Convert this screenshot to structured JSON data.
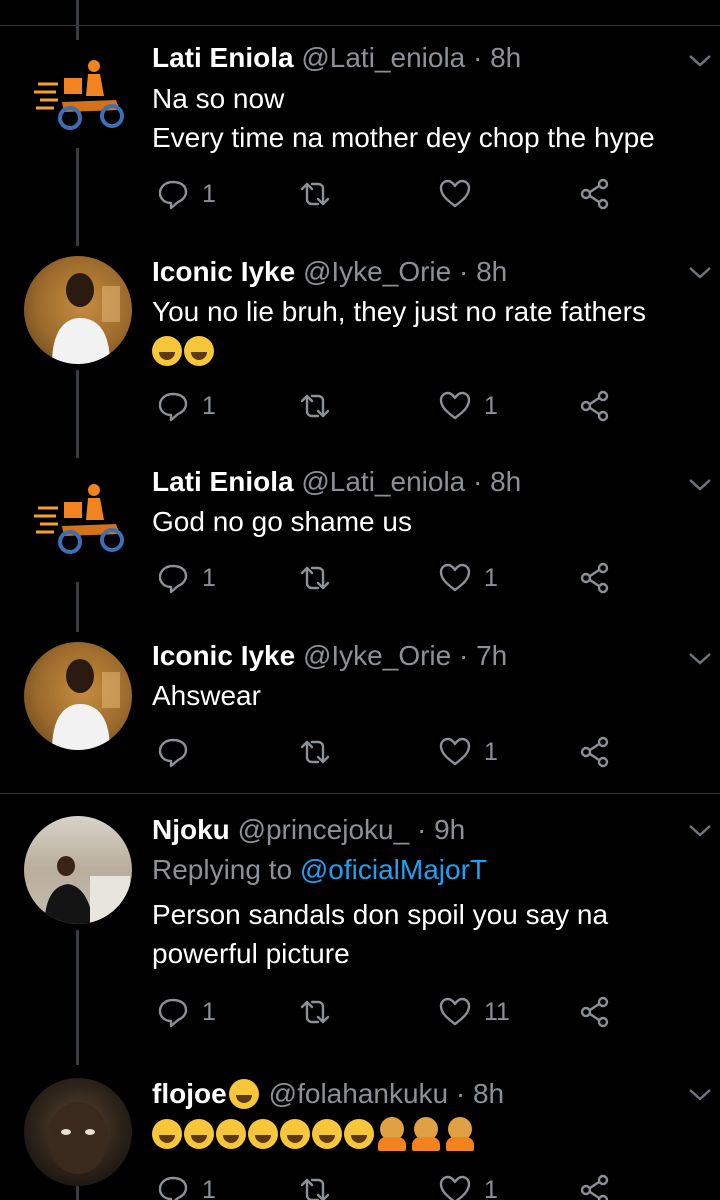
{
  "tweets": [
    {
      "name": "Lati Eniola",
      "meta": "@Lati_eniola · 8h",
      "lines": [
        "Na so now",
        "Every time na mother dey chop the hype"
      ],
      "replies": "1",
      "retweets": "",
      "likes": "",
      "avatar": "rider-logo"
    },
    {
      "name": "Iconic Iyke",
      "meta": "@Iyke_Orie · 8h",
      "lines": [
        "You no lie bruh, they just no rate fathers"
      ],
      "emojis": [
        "face-with-tears-of-joy",
        "grinning-squinting-face"
      ],
      "replies": "1",
      "retweets": "",
      "likes": "1",
      "avatar": "profile-photo"
    },
    {
      "name": "Lati Eniola",
      "meta": "@Lati_eniola · 8h",
      "lines": [
        "God no go shame us"
      ],
      "replies": "1",
      "retweets": "",
      "likes": "1",
      "avatar": "rider-logo"
    },
    {
      "name": "Iconic Iyke",
      "meta": "@Iyke_Orie · 7h",
      "lines": [
        "Ahswear"
      ],
      "replies": "",
      "retweets": "",
      "likes": "1",
      "avatar": "profile-photo"
    },
    {
      "name": "Njoku",
      "meta": "@princejoku_ · 9h",
      "replying_prefix": "Replying to",
      "replying_handle": "@oficialMajorT",
      "lines": [
        "Person sandals don spoil you say na",
        "powerful picture"
      ],
      "replies": "1",
      "retweets": "",
      "likes": "11",
      "avatar": "profile-photo"
    },
    {
      "name": "flojoe",
      "name_emoji": "winking-face",
      "meta": "@folahankuku · 8h",
      "emojis": [
        "rolling-on-floor-laughing",
        "rolling-on-floor-laughing",
        "rolling-on-floor-laughing",
        "rolling-on-floor-laughing",
        "rolling-on-floor-laughing",
        "rolling-on-floor-laughing",
        "rolling-on-floor-laughing",
        "person-facepalming",
        "person-facepalming",
        "person-facepalming"
      ],
      "replies": "1",
      "retweets": "",
      "likes": "1",
      "avatar": "profile-photo"
    }
  ],
  "colors": {
    "background": "#000000",
    "secondary_text": "#8b9197",
    "link": "#1da1f2",
    "divider": "#2f3336"
  }
}
